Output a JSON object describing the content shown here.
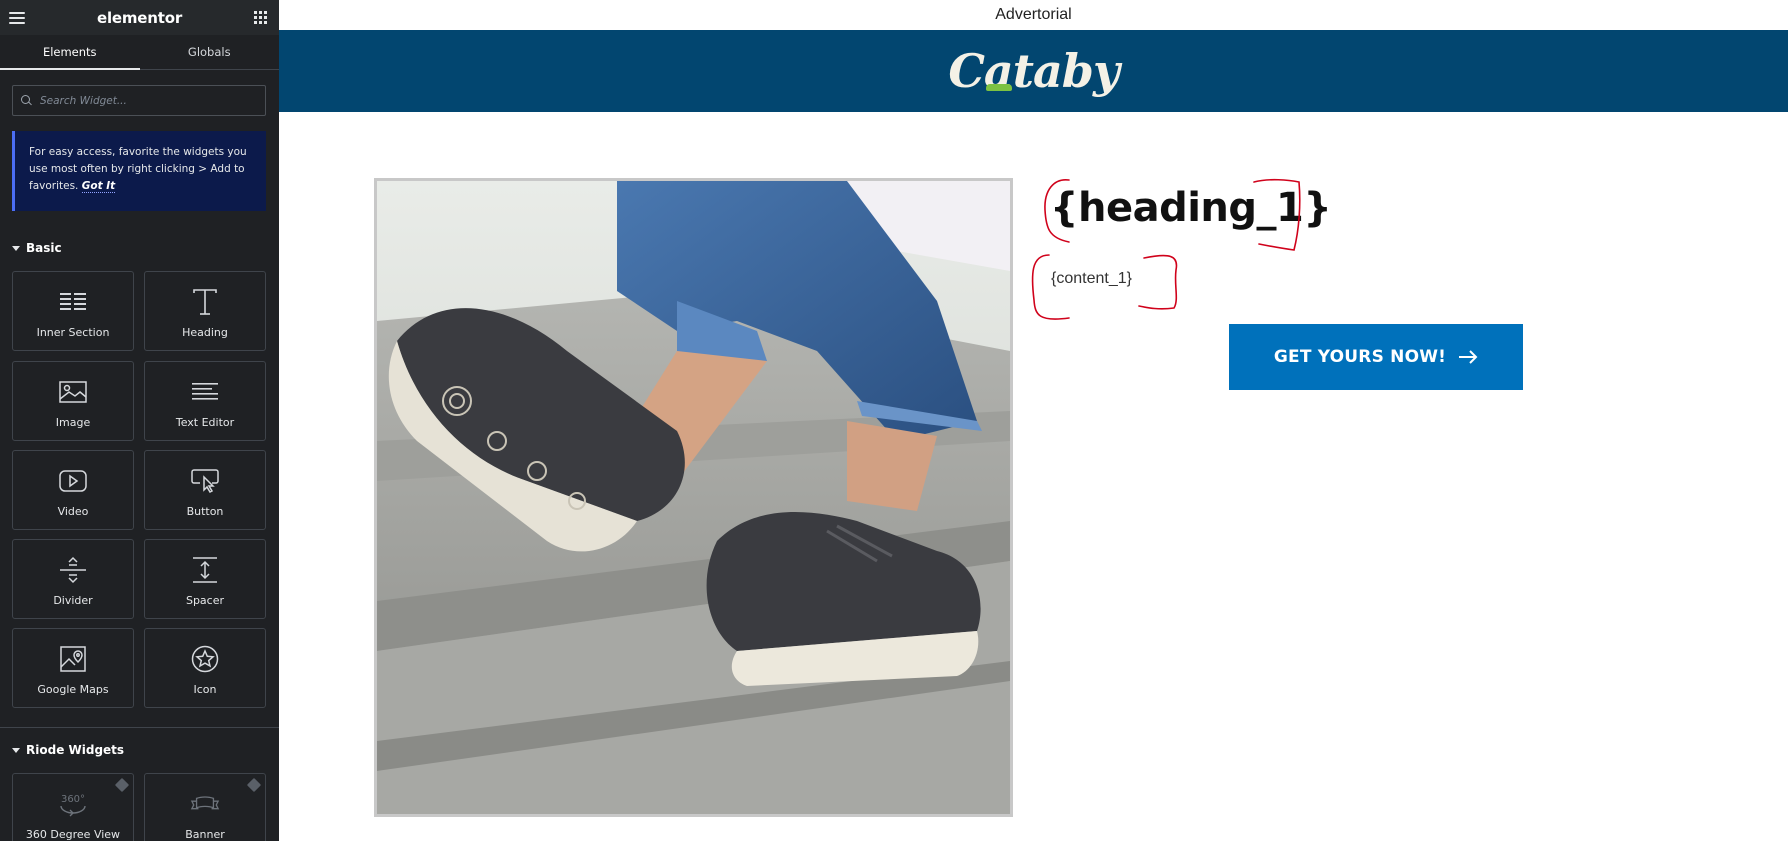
{
  "editor": {
    "logo": "elementor",
    "tabs": [
      {
        "label": "Elements",
        "active": true
      },
      {
        "label": "Globals",
        "active": false
      }
    ],
    "search": {
      "placeholder": "Search Widget..."
    },
    "notice": {
      "text": "For easy access, favorite the widgets you use most often by right clicking > Add to favorites.",
      "action": "Got It"
    },
    "sections": [
      {
        "title": "Basic"
      },
      {
        "title": "Riode Widgets"
      }
    ],
    "basic_widgets": [
      {
        "label": "Inner Section",
        "icon": "inner-section-icon"
      },
      {
        "label": "Heading",
        "icon": "heading-icon"
      },
      {
        "label": "Image",
        "icon": "image-icon"
      },
      {
        "label": "Text Editor",
        "icon": "text-editor-icon"
      },
      {
        "label": "Video",
        "icon": "video-icon"
      },
      {
        "label": "Button",
        "icon": "button-icon"
      },
      {
        "label": "Divider",
        "icon": "divider-icon"
      },
      {
        "label": "Spacer",
        "icon": "spacer-icon"
      },
      {
        "label": "Google Maps",
        "icon": "google-maps-icon"
      },
      {
        "label": "Icon",
        "icon": "star-icon"
      }
    ],
    "riode_widgets": [
      {
        "label": "360 Degree View",
        "icon": "360-view-icon"
      },
      {
        "label": "Banner",
        "icon": "banner-icon"
      }
    ]
  },
  "page": {
    "top_label": "Advertorial",
    "brand": "Cataby",
    "heading": "{heading_1}",
    "content": "{content_1}",
    "cta": "GET YOURS NOW!",
    "colors": {
      "brand_bar": "#024670",
      "cta": "#0071bb",
      "annotation": "#d0021b"
    }
  }
}
